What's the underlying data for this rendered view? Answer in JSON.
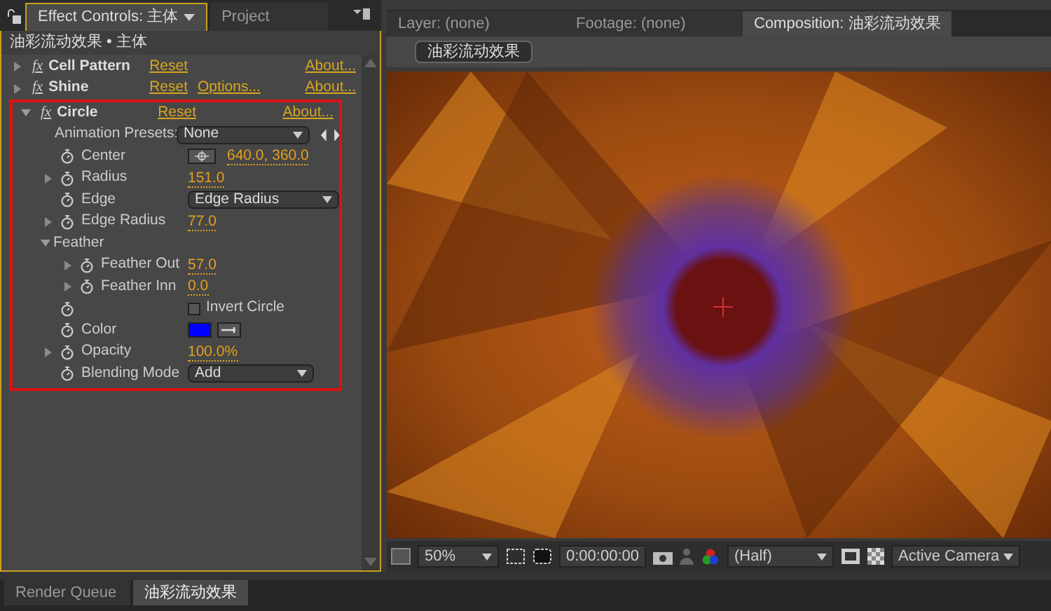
{
  "effect_panel": {
    "tabs": [
      {
        "label": "Effect Controls: 主体",
        "selected": true
      },
      {
        "label": "Project",
        "selected": false
      }
    ],
    "header": "油彩流动效果 • 主体",
    "effects": [
      {
        "badge": "fx",
        "name": "Cell Pattern",
        "expanded": false,
        "links": [
          "Reset",
          "About..."
        ]
      },
      {
        "badge": "fx",
        "name": "Shine",
        "expanded": false,
        "links": [
          "Reset",
          "Options...",
          "About..."
        ]
      },
      {
        "badge": "fx",
        "name": "Circle",
        "expanded": true,
        "links": [
          "Reset",
          "About..."
        ],
        "presets": {
          "label": "Animation Presets:",
          "value": "None"
        },
        "properties": [
          {
            "kind": "point",
            "label": "Center",
            "value": "640.0, 360.0"
          },
          {
            "kind": "number",
            "label": "Radius",
            "value": "151.0"
          },
          {
            "kind": "dropdown",
            "label": "Edge",
            "value": "Edge Radius"
          },
          {
            "kind": "number",
            "label": "Edge Radius",
            "value": "77.0"
          },
          {
            "kind": "group",
            "label": "Feather",
            "expanded": true,
            "children": [
              {
                "kind": "number",
                "label": "Feather Out",
                "value": "57.0"
              },
              {
                "kind": "number",
                "label": "Feather Inn",
                "value": "0.0"
              }
            ]
          },
          {
            "kind": "checkbox",
            "value": "Invert Circle",
            "checked": false
          },
          {
            "kind": "color",
            "label": "Color",
            "color": "#0000ff"
          },
          {
            "kind": "number",
            "label": "Opacity",
            "value": "100.0%"
          },
          {
            "kind": "dropdown",
            "label": "Blending Mode",
            "value": "Add"
          }
        ]
      }
    ]
  },
  "viewer": {
    "tabs": [
      {
        "label": "Layer: (none)",
        "selected": false
      },
      {
        "label": "Footage: (none)",
        "selected": false
      },
      {
        "label": "Composition: 油彩流动效果",
        "selected": true
      }
    ],
    "comp_button": "油彩流动效果",
    "toolbar": {
      "zoom": "50%",
      "timecode": "0:00:00:00",
      "resolution": "(Half)",
      "camera": "Active Camera"
    }
  },
  "bottom_tabs": [
    {
      "label": "Render Queue",
      "selected": false
    },
    {
      "label": "油彩流动效果",
      "selected": true
    }
  ]
}
